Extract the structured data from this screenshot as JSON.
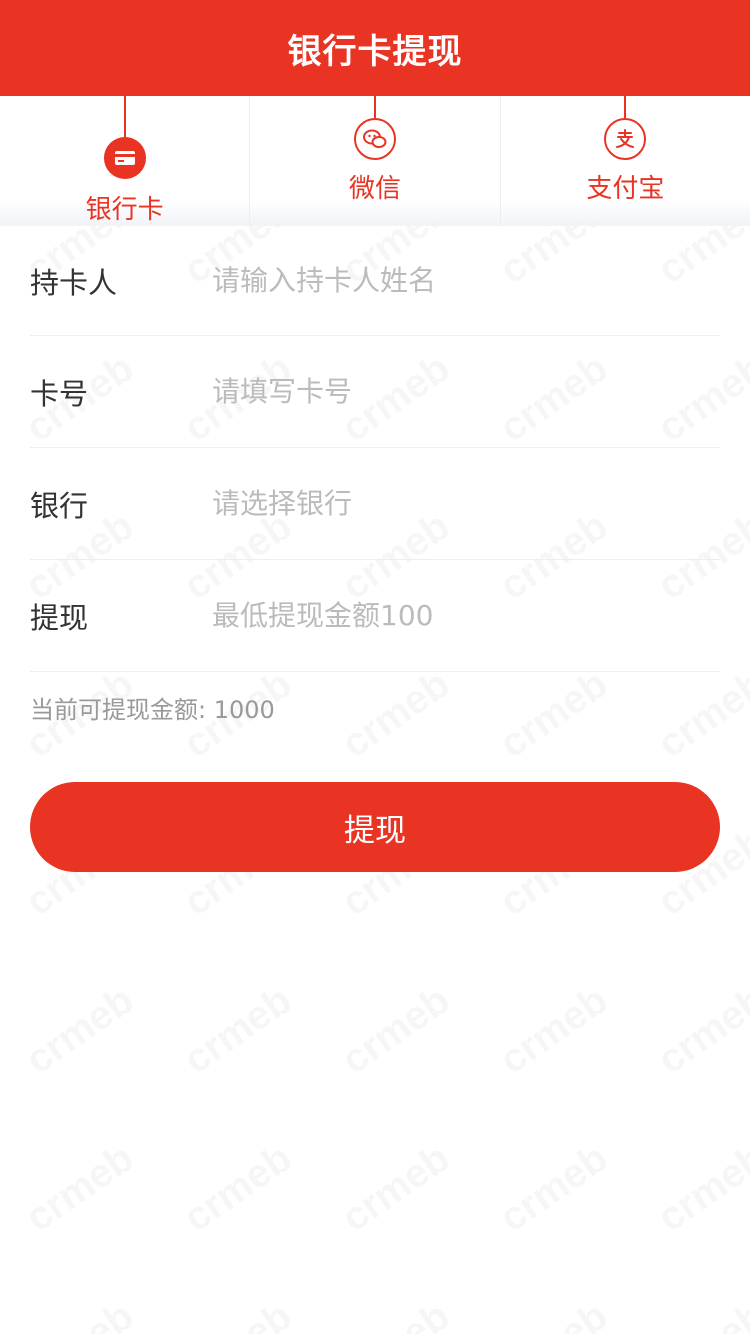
{
  "header": {
    "title": "银行卡提现"
  },
  "tabs": [
    {
      "label": "银行卡",
      "icon": "bank-card-icon",
      "active": true
    },
    {
      "label": "微信",
      "icon": "wechat-icon",
      "active": false
    },
    {
      "label": "支付宝",
      "icon": "alipay-icon",
      "active": false
    }
  ],
  "form": {
    "cardholder": {
      "label": "持卡人",
      "placeholder": "请输入持卡人姓名"
    },
    "card_number": {
      "label": "卡号",
      "placeholder": "请填写卡号"
    },
    "bank": {
      "label": "银行",
      "placeholder": "请选择银行"
    },
    "amount": {
      "label": "提现",
      "placeholder": "最低提现金额100"
    }
  },
  "balance_text": "当前可提现金额: 1000",
  "submit_label": "提现",
  "watermark_text": "crmeb",
  "colors": {
    "accent": "#e93323",
    "text": "#333333",
    "placeholder": "#bbbbbb",
    "muted": "#999999"
  }
}
